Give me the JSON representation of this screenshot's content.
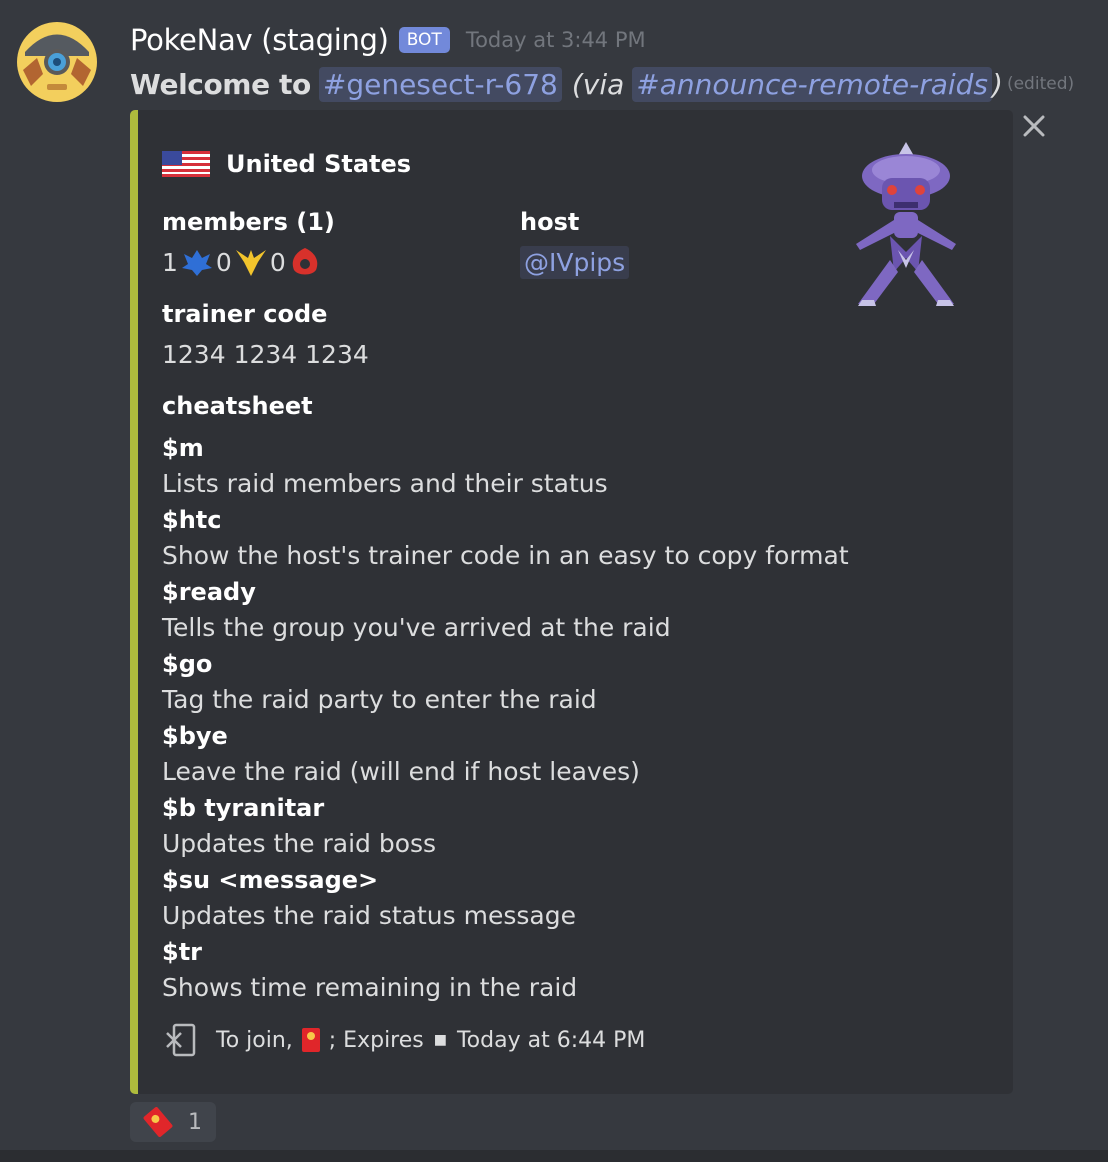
{
  "message": {
    "username": "PokeNav (staging)",
    "bot_tag": "BOT",
    "timestamp": "Today at 3:44 PM",
    "welcome": "Welcome to",
    "channel": "#genesect-r-678",
    "via_open": "(via",
    "via_channel": "#announce-remote-raids",
    "via_close": ")",
    "edited": "(edited)"
  },
  "embed": {
    "accent_color": "#aebb3d",
    "country": "United States",
    "members_label": "members (1)",
    "team_counts": [
      "1",
      "0",
      "0"
    ],
    "host_label": "host",
    "host_mention": "@IVpips",
    "trainer_code_label": "trainer code",
    "trainer_code": "1234 1234 1234",
    "cheatsheet_label": "cheatsheet",
    "commands": [
      {
        "cmd": "$m",
        "desc": "Lists raid members and their status"
      },
      {
        "cmd": "$htc",
        "desc": "Show the host's trainer code in an easy to copy format"
      },
      {
        "cmd": "$ready",
        "desc": "Tells the group you've arrived at the raid"
      },
      {
        "cmd": "$go",
        "desc": "Tag the raid party to enter the raid"
      },
      {
        "cmd": "$bye",
        "desc": "Leave the raid (will end if host leaves)"
      },
      {
        "cmd": "$b tyranitar",
        "desc": "Updates the raid boss"
      },
      {
        "cmd": "$su <message>",
        "desc": "Updates the raid status message"
      },
      {
        "cmd": "$tr",
        "desc": "Shows time remaining in the raid"
      }
    ],
    "footer": {
      "join_text": "To join,",
      "expires_text": "; Expires",
      "expires_time": "Today at 6:44 PM"
    }
  },
  "reaction": {
    "count": "1"
  }
}
